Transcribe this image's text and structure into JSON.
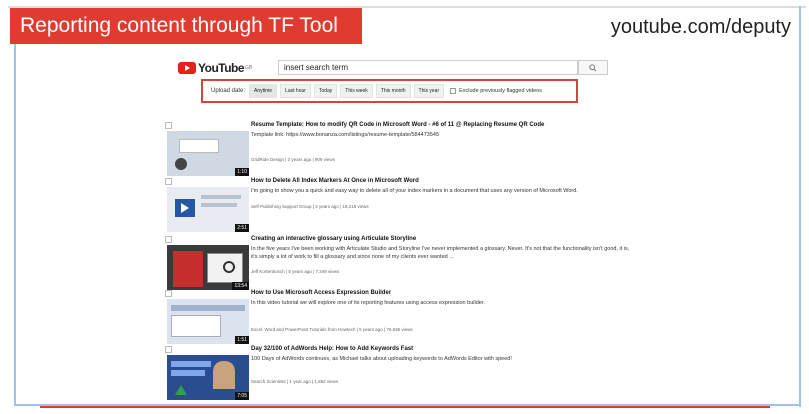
{
  "banner": {
    "title": "Reporting content through TF Tool",
    "url": "youtube.com/deputy"
  },
  "youtube": {
    "logo_text": "YouTube",
    "logo_sup": "GB"
  },
  "search": {
    "value": "insert search term",
    "button_icon": "search-icon"
  },
  "filters": {
    "label": "Upload date:",
    "options": [
      "Anytime",
      "Last hour",
      "Today",
      "This week",
      "This month",
      "This year"
    ],
    "selected": "Anytime",
    "checkbox_label": "Exclude previously flagged videos"
  },
  "results": [
    {
      "title": "Resume Template: How to modify QR Code in Microsoft Word - #6 of 11 @ Replacing Resume QR Code",
      "desc": "Template link: https://www.bonanza.com/listings/resume-template/584473545",
      "meta": "GridRide Design | 2 years ago | 909 views",
      "duration": "1:10",
      "thumb_color": "#cfd9e4"
    },
    {
      "title": "How to Delete All Index Markers At Once in Microsoft Word",
      "desc": "I'm going to show you a quick and easy way to delete all of your index markers in a document that uses any version of Microsoft Word.",
      "meta": "Self Publishing Support Group | 2 years ago | 19,218 views",
      "duration": "2:51",
      "thumb_color": "#e8ecf2"
    },
    {
      "title": "Creating an interactive glossary using Articulate Storyline",
      "desc": "In the five years I've been working with Articulate Studio and Storyline I've never implemented a glossary. Never. It's not that the functionality isn't good, it is, it's simply a lot of work to fill a glossary and since none of my clients ever wanted ...",
      "meta": "Jeff Kortenbosch | 5 years ago | 7,349 views",
      "duration": "13:54",
      "thumb_color": "#3a3a3a"
    },
    {
      "title": "How to Use Microsoft Access Expression Builder",
      "desc": "In this video tutorial we will explore one of its reporting features using access expression builder.",
      "meta": "Excel, Word and PowerPoint Tutorials from Howtech | 5 years ago | 76,636 views",
      "duration": "1:51",
      "thumb_color": "#dbe4ee"
    },
    {
      "title": "Day 32/100 of AdWords Help: How to Add Keywords Fast",
      "desc": "100 Days of AdWords continues, as Michael talks about uploading keywords to AdWords Editor with speed!",
      "meta": "Search Scientists | 1 year ago | 1,852 views",
      "duration": "7:05",
      "thumb_color": "#2a4d8f"
    }
  ]
}
